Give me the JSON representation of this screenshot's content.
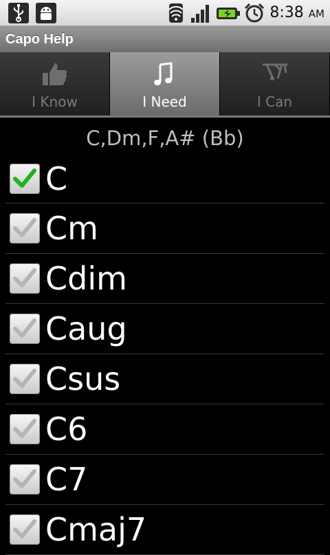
{
  "status_bar": {
    "time": "8:38",
    "ampm": "AM",
    "icons": [
      "usb-icon",
      "android-debug-icon",
      "wifi-icon",
      "signal-icon",
      "battery-charging-icon",
      "alarm-icon"
    ]
  },
  "app": {
    "title": "Capo Help"
  },
  "tabs": [
    {
      "label": "I Know",
      "icon": "thumbs-up-icon",
      "selected": false
    },
    {
      "label": "I Need",
      "icon": "music-note-icon",
      "selected": true
    },
    {
      "label": "I Can",
      "icon": "capo-icon",
      "selected": false
    }
  ],
  "chord_header": "C,Dm,F,A# (Bb)",
  "chords": [
    {
      "label": "C",
      "checked": true
    },
    {
      "label": "Cm",
      "checked": false
    },
    {
      "label": "Cdim",
      "checked": false
    },
    {
      "label": "Caug",
      "checked": false
    },
    {
      "label": "Csus",
      "checked": false
    },
    {
      "label": "C6",
      "checked": false
    },
    {
      "label": "C7",
      "checked": false
    },
    {
      "label": "Cmaj7",
      "checked": false
    }
  ],
  "colors": {
    "check_on": "#22b11f",
    "check_off": "#b5b5b5"
  }
}
